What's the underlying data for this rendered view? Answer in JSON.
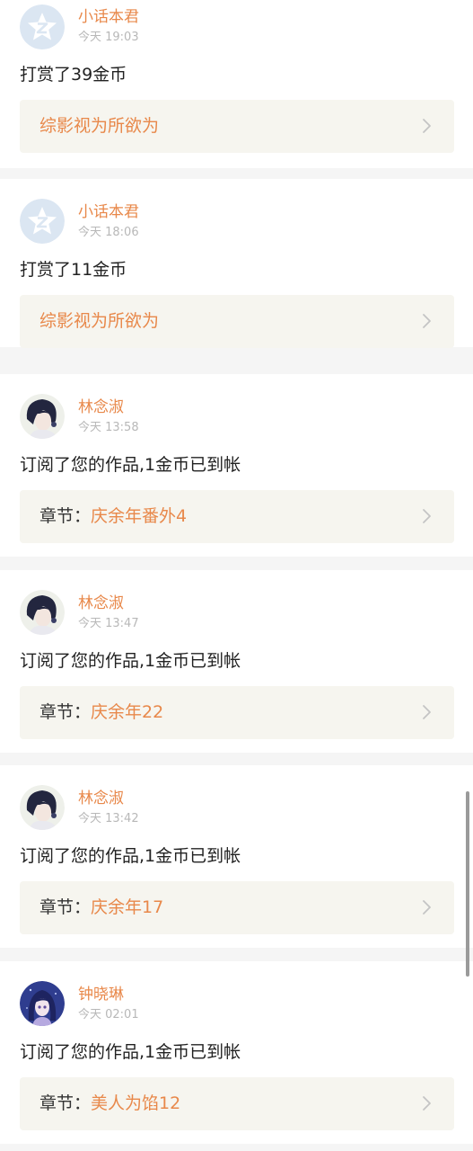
{
  "colors": {
    "accent": "#e8884a",
    "message_text": "#222222",
    "timestamp": "#b8b8b8",
    "link_box_bg": "#f6f5ef",
    "page_bg": "#f5f5f5"
  },
  "notifications": [
    {
      "avatar": "qzone-star-avatar",
      "username": "小话本君",
      "time": "今天 19:03",
      "message": "打赏了39金币",
      "link_prefix": "",
      "link_title": "综影视为所欲为"
    },
    {
      "avatar": "qzone-star-avatar",
      "username": "小话本君",
      "time": "今天 18:06",
      "message": "打赏了11金币",
      "link_prefix": "",
      "link_title": "综影视为所欲为"
    },
    {
      "avatar": "girl-photo-avatar",
      "username": "林念淑",
      "time": "今天 13:58",
      "message": "订阅了您的作品,1金币已到帐",
      "link_prefix": "章节：",
      "link_title": "庆余年番外4"
    },
    {
      "avatar": "girl-photo-avatar",
      "username": "林念淑",
      "time": "今天 13:47",
      "message": "订阅了您的作品,1金币已到帐",
      "link_prefix": "章节：",
      "link_title": "庆余年22"
    },
    {
      "avatar": "girl-photo-avatar",
      "username": "林念淑",
      "time": "今天 13:42",
      "message": "订阅了您的作品,1金币已到帐",
      "link_prefix": "章节：",
      "link_title": "庆余年17"
    },
    {
      "avatar": "anime-girl-avatar",
      "username": "钟晓琳",
      "time": "今天 02:01",
      "message": "订阅了您的作品,1金币已到帐",
      "link_prefix": "章节：",
      "link_title": "美人为馅12"
    }
  ]
}
